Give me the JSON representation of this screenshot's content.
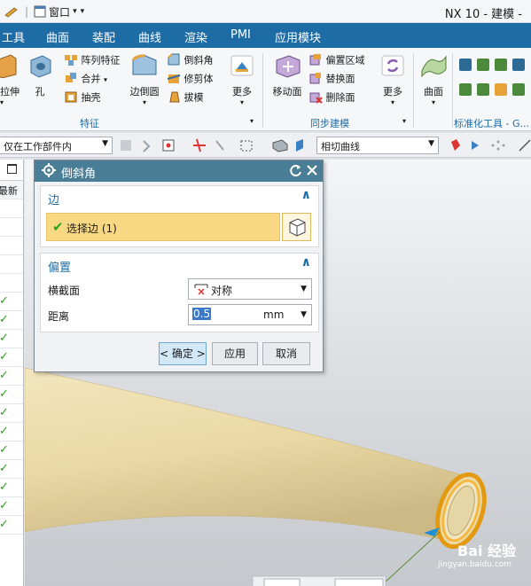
{
  "titlebar": {
    "window_menu": "窗口",
    "title": "NX 10 - 建模 -"
  },
  "menubar": {
    "items": [
      "工具",
      "曲面",
      "装配",
      "曲线",
      "渲染",
      "PMI",
      "应用模块"
    ]
  },
  "ribbon": {
    "extrude_label": "拉伸",
    "hole_label": "孔",
    "pattern_feature": "阵列特征",
    "unite": "合并",
    "shell": "抽壳",
    "edge_blend": "边倒圆",
    "chamfer": "倒斜角",
    "trim_body": "修剪体",
    "draft": "拔模",
    "more1": "更多",
    "group_feature": "特征",
    "move_face": "移动面",
    "offset_region": "偏置区域",
    "replace_face": "替换面",
    "delete_face": "删除面",
    "more2": "更多",
    "group_sync": "同步建模",
    "surface": "曲面",
    "group_standard": "标准化工具 - G..."
  },
  "filterbar": {
    "scope": "仅在工作部件内",
    "curve_rule": "相切曲线"
  },
  "navigator": {
    "header": "最新",
    "rows": 18,
    "check_rows": [
      5,
      6,
      7,
      8,
      9,
      10,
      11,
      12,
      13,
      14,
      15,
      16,
      17
    ]
  },
  "dialog": {
    "title": "倒斜角",
    "edge_section": "边",
    "select_edge": "选择边 (1)",
    "offset_section": "偏置",
    "cross_section_label": "横截面",
    "cross_section_value": "对称",
    "distance_label": "距离",
    "distance_value": "0.5",
    "distance_unit": "mm",
    "ok": "< 确定 >",
    "apply": "应用",
    "cancel": "取消"
  },
  "watermark": {
    "text": "Bai 经验",
    "url": "jingyan.baidu.com"
  },
  "colors": {
    "menubar": "#1e6ca6",
    "dialog_title": "#4a7e96",
    "selection_highlight": "#f8d883",
    "tube": "#eadcae",
    "edge_highlight": "#f2a516"
  }
}
